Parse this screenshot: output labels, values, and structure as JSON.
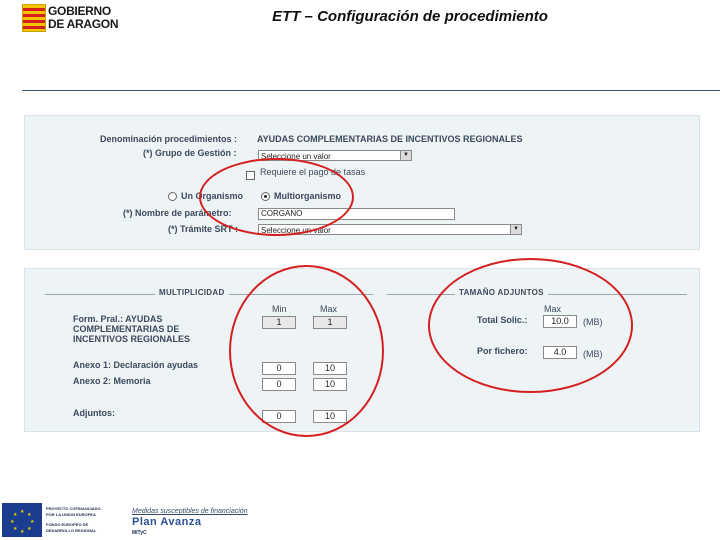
{
  "header": {
    "logo_line1": "GOBIERNO",
    "logo_line2": "DE ARAGON",
    "title": "ETT – Configuración de procedimiento"
  },
  "form": {
    "denominacion_label": "Denominación procedimientos :",
    "denominacion_value": "AYUDAS COMPLEMENTARIAS DE INCENTIVOS REGIONALES",
    "grupo_label": "(*) Grupo de Gestión :",
    "grupo_value": "Seleccione un valor",
    "tasas_label": "Requiere el pago de tasas",
    "un_organismo_label": "Un Organismo",
    "multiorganismo_label": "Multiorganismo",
    "selected_mode": "Multiorganismo",
    "parametro_label": "(*) Nombre de parámetro:",
    "parametro_value": "CORGANO",
    "tramite_label": "(*) Trámite SRT :",
    "tramite_value": "Seleccione un valor"
  },
  "multiplicidad": {
    "title": "MULTIPLICIDAD",
    "min_header": "Min",
    "max_header": "Max",
    "rows": [
      {
        "label_lines": [
          "Form. Pral.: AYUDAS",
          "COMPLEMENTARIAS DE",
          "INCENTIVOS REGIONALES"
        ],
        "min": "1",
        "max": "1"
      },
      {
        "label_lines": [
          "Anexo 1: Declaración ayudas"
        ],
        "min": "0",
        "max": "10"
      },
      {
        "label_lines": [
          "Anexo 2: Memoria"
        ],
        "min": "0",
        "max": "10"
      },
      {
        "label_lines": [
          "Adjuntos:"
        ],
        "min": "0",
        "max": "10"
      }
    ]
  },
  "tamano": {
    "title": "TAMAÑO ADJUNTOS",
    "max_header": "Max",
    "total_label": "Total Solic.:",
    "total_value": "10.0",
    "total_unit": "(MB)",
    "fichero_label": "Por fichero:",
    "fichero_value": "4.0",
    "fichero_unit": "(MB)"
  },
  "footer": {
    "funding_note": "Medidas susceptibles de financiación",
    "eu_text": [
      "PROYECTO COFINANCIADO",
      "POR LA UNION EUROPEA",
      "FONDO EUROPEO DE",
      "DESARROLLO REGIONAL"
    ],
    "avanza": "Plan Avanza",
    "plan": "MITyC"
  },
  "annotation_color": "#d42020"
}
